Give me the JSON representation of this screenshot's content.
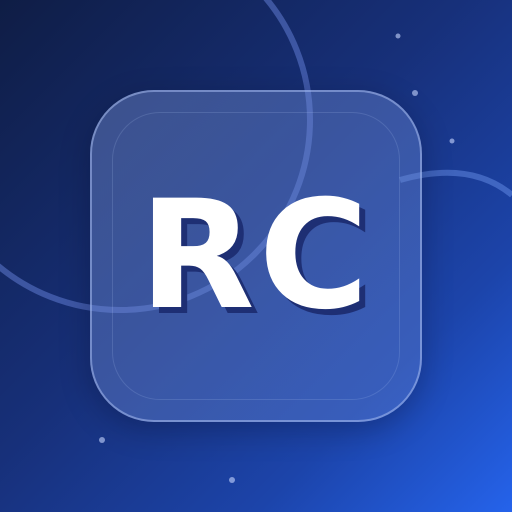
{
  "app_icon": {
    "monogram": "RC",
    "colors": {
      "background_start": "#0f1d45",
      "background_end": "#2563eb",
      "tile_border": "#aabef0",
      "text": "#ffffff",
      "text_shadow": "#1e2f74"
    }
  }
}
